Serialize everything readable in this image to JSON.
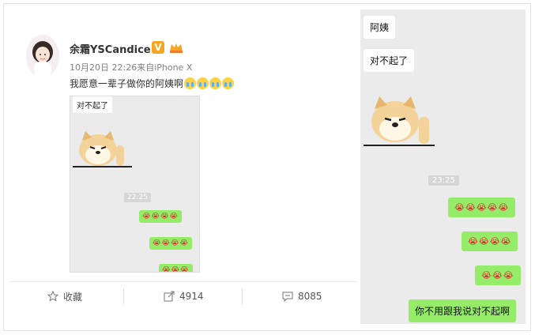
{
  "post": {
    "username": "余霜YSCandice",
    "verified_badge": "V",
    "meta": "10月20日 22:26来自iPhone X",
    "text": "我愿意一辈子做你的阿姨啊",
    "emoji_count": 4
  },
  "thumbnail": {
    "bubble": "对不起了",
    "time": "22:25",
    "green_rows": [
      "😭😭😭😭",
      "😭😭😭😭",
      "😭😭😭"
    ]
  },
  "actions": {
    "favorite_label": "收藏",
    "repost_count": "4914",
    "comment_count": "8085"
  },
  "chat": {
    "msg1": "阿姨",
    "msg2": "对不起了",
    "time": "23:25",
    "green1": "😭😭😭😭😭",
    "green2": "😭😭😭😭",
    "green3": "😭😭😭",
    "green4": "你不用跟我说对不起啊"
  },
  "colors": {
    "accent_green": "#95ec69",
    "badge_orange": "#f6a623"
  }
}
